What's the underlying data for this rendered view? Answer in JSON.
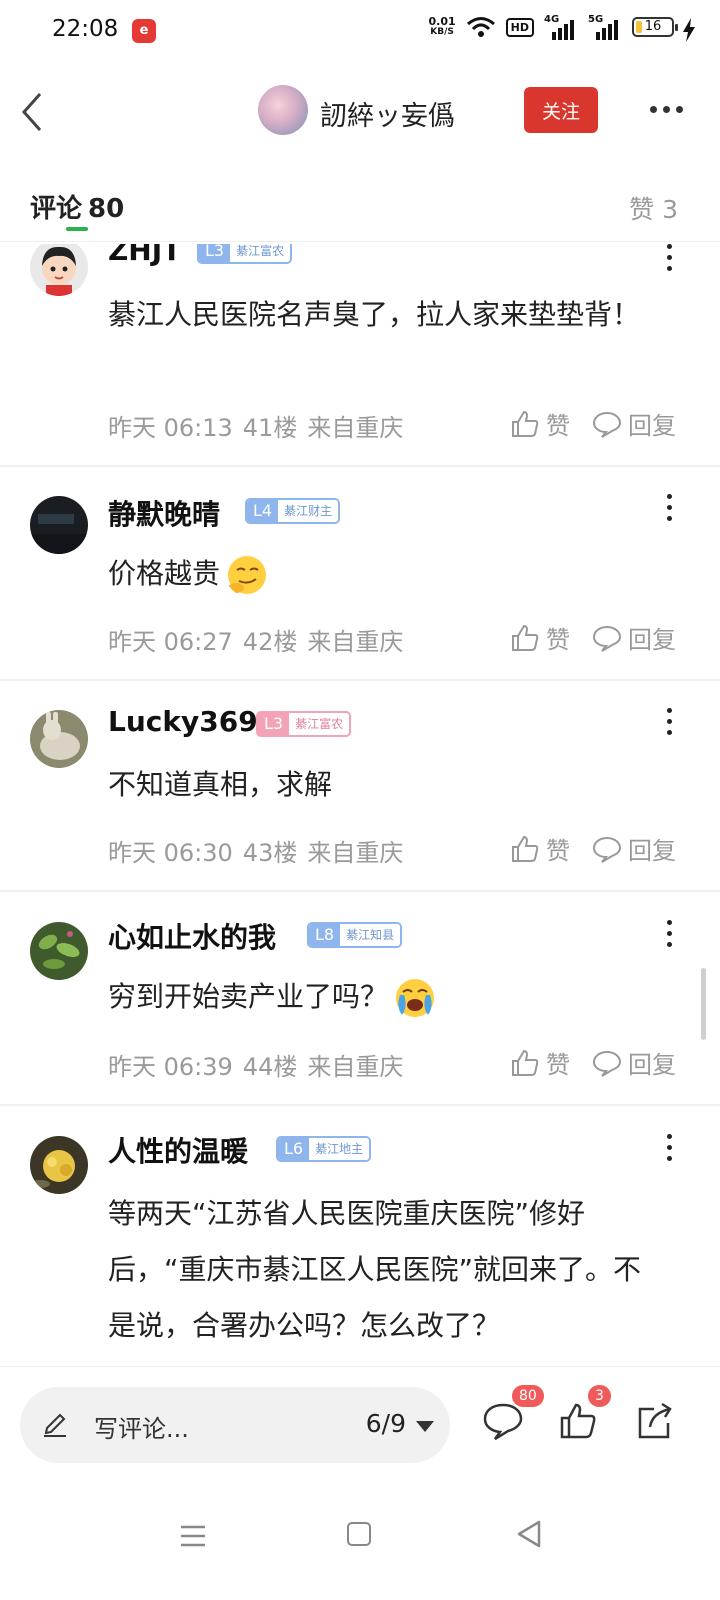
{
  "status_bar": {
    "time": "22:08",
    "app_icon": "e",
    "net_speed_value": "0.01",
    "net_speed_unit": "KB/S",
    "hd_label": "HD",
    "net1": "4G",
    "net2": "5G",
    "battery": "16",
    "icons": [
      "wifi-icon",
      "signal-icon",
      "battery-icon",
      "charging-icon"
    ]
  },
  "header": {
    "username": "訒綷ッ妄僞",
    "follow_label": "关注"
  },
  "tabs": {
    "comments_label": "评论",
    "comments_count": "80",
    "likes_label": "赞 3"
  },
  "comments": [
    {
      "name": "ZHJT",
      "level": "L3",
      "title": "綦江富农",
      "badge_color": "blue",
      "text": "綦江人民医院名声臭了，拉人家来垫垫背！",
      "time": "昨天 06:13",
      "floor": "41楼",
      "location": "来自重庆",
      "like_label": "赞",
      "reply_label": "回复"
    },
    {
      "name": "静默晚晴",
      "level": "L4",
      "title": "綦江财主",
      "badge_color": "blue",
      "text": "价格越贵",
      "emoji": "smirk-emoji",
      "time": "昨天 06:27",
      "floor": "42楼",
      "location": "来自重庆",
      "like_label": "赞",
      "reply_label": "回复"
    },
    {
      "name": "Lucky369",
      "level": "L3",
      "title": "綦江富农",
      "badge_color": "pink",
      "text": "不知道真相，求解",
      "time": "昨天 06:30",
      "floor": "43楼",
      "location": "来自重庆",
      "like_label": "赞",
      "reply_label": "回复"
    },
    {
      "name": "心如止水的我",
      "level": "L8",
      "title": "綦江知县",
      "badge_color": "blue",
      "text": "穷到开始卖产业了吗？",
      "emoji": "crying-emoji",
      "time": "昨天 06:39",
      "floor": "44楼",
      "location": "来自重庆",
      "like_label": "赞",
      "reply_label": "回复"
    },
    {
      "name": "人性的温暖",
      "level": "L6",
      "title": "綦江地主",
      "badge_color": "blue",
      "text": "等两天“江苏省人民医院重庆医院”修好后，“重庆市綦江区人民医院”就回来了。不是说，合署办公吗？怎么改了？",
      "time": "",
      "floor": "",
      "location": "",
      "like_label": "",
      "reply_label": ""
    }
  ],
  "bottom_bar": {
    "comment_placeholder": "写评论...",
    "page_indicator": "6/9",
    "comment_count_badge": "80",
    "like_count_badge": "3"
  }
}
